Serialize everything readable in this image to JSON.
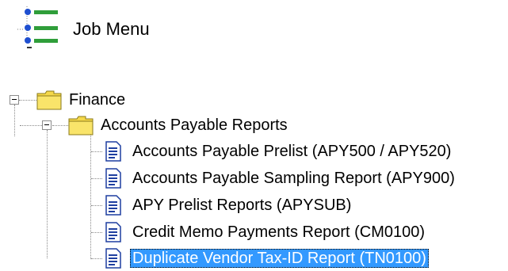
{
  "header": {
    "title": "Job Menu",
    "icon": "job-menu-list-icon"
  },
  "tree": {
    "root": {
      "label": "Finance",
      "expanded": true,
      "icon": "folder-icon",
      "children": [
        {
          "label": "Accounts Payable Reports",
          "expanded": true,
          "icon": "folder-icon",
          "children": [
            {
              "label": "Accounts Payable Prelist (APY500 / APY520)",
              "icon": "report-document-icon",
              "selected": false
            },
            {
              "label": "Accounts Payable Sampling Report (APY900)",
              "icon": "report-document-icon",
              "selected": false
            },
            {
              "label": "APY Prelist Reports (APYSUB)",
              "icon": "report-document-icon",
              "selected": false
            },
            {
              "label": "Credit Memo Payments Report (CM0100)",
              "icon": "report-document-icon",
              "selected": false
            },
            {
              "label": "Duplicate Vendor Tax-ID Report (TN0100)",
              "icon": "report-document-icon",
              "selected": true
            }
          ]
        }
      ]
    }
  },
  "colors": {
    "selection_background": "#3399ff",
    "selection_text": "#ffffff",
    "folder_yellow": "#f5d84a",
    "bullet_blue": "#1f4fd0",
    "bullet_bar_green": "#2f9e3a"
  }
}
